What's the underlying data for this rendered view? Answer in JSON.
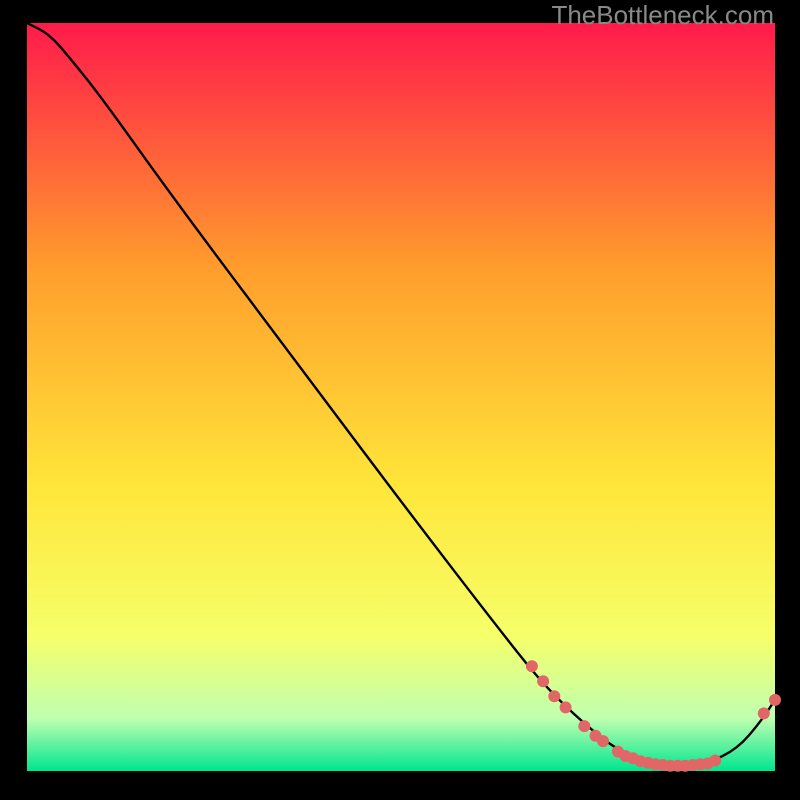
{
  "watermark": {
    "text": "TheBottleneck.com"
  },
  "colors": {
    "top": "#ff1a4b",
    "mid1": "#ff9e2c",
    "mid2": "#ffe63a",
    "mid3": "#f6ff6a",
    "band": "#bfffb0",
    "bottom": "#00e58f",
    "curve": "#000000",
    "dot": "#e16767"
  },
  "chart_data": {
    "type": "line",
    "title": "",
    "xlabel": "",
    "ylabel": "",
    "xlim": [
      0,
      100
    ],
    "ylim": [
      0,
      100
    ],
    "legend": false,
    "grid": false,
    "curve": [
      {
        "x": 0.0,
        "y": 100.0
      },
      {
        "x": 3.0,
        "y": 98.5
      },
      {
        "x": 6.0,
        "y": 95.0
      },
      {
        "x": 10.0,
        "y": 90.0
      },
      {
        "x": 20.0,
        "y": 76.0
      },
      {
        "x": 35.0,
        "y": 56.0
      },
      {
        "x": 50.0,
        "y": 36.0
      },
      {
        "x": 65.0,
        "y": 16.5
      },
      {
        "x": 70.0,
        "y": 10.5
      },
      {
        "x": 76.0,
        "y": 5.0
      },
      {
        "x": 80.0,
        "y": 2.2
      },
      {
        "x": 85.0,
        "y": 0.8
      },
      {
        "x": 91.0,
        "y": 1.0
      },
      {
        "x": 95.0,
        "y": 3.0
      },
      {
        "x": 98.0,
        "y": 6.5
      },
      {
        "x": 100.0,
        "y": 9.5
      }
    ],
    "points": [
      {
        "x": 67.5,
        "y": 14.0
      },
      {
        "x": 69.0,
        "y": 12.0
      },
      {
        "x": 70.5,
        "y": 10.0
      },
      {
        "x": 72.0,
        "y": 8.5
      },
      {
        "x": 74.5,
        "y": 6.0
      },
      {
        "x": 76.0,
        "y": 4.7
      },
      {
        "x": 77.0,
        "y": 4.0
      },
      {
        "x": 79.0,
        "y": 2.6
      },
      {
        "x": 80.0,
        "y": 2.0
      },
      {
        "x": 81.0,
        "y": 1.7
      },
      {
        "x": 82.0,
        "y": 1.3
      },
      {
        "x": 83.0,
        "y": 1.1
      },
      {
        "x": 84.0,
        "y": 0.9
      },
      {
        "x": 85.0,
        "y": 0.8
      },
      {
        "x": 86.0,
        "y": 0.7
      },
      {
        "x": 87.0,
        "y": 0.7
      },
      {
        "x": 88.0,
        "y": 0.7
      },
      {
        "x": 89.0,
        "y": 0.8
      },
      {
        "x": 90.0,
        "y": 0.9
      },
      {
        "x": 91.0,
        "y": 1.0
      },
      {
        "x": 92.0,
        "y": 1.4
      },
      {
        "x": 98.5,
        "y": 7.7
      },
      {
        "x": 100.0,
        "y": 9.5
      }
    ]
  }
}
